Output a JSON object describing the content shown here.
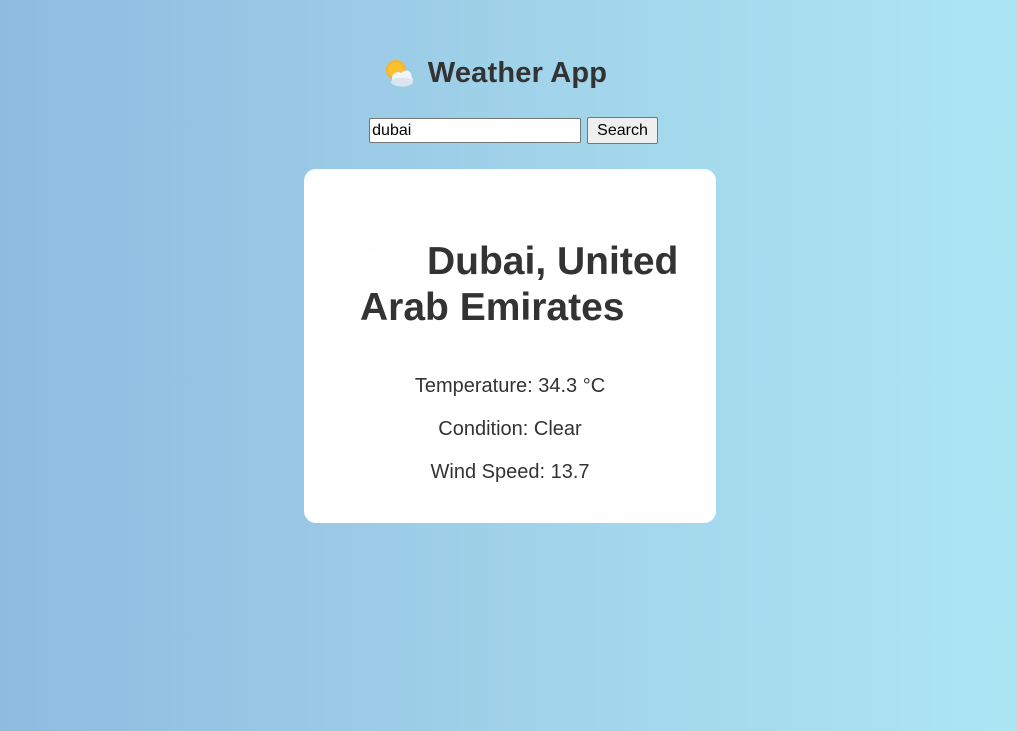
{
  "header": {
    "title": "Weather App",
    "icon": "sun-behind-cloud-icon"
  },
  "search": {
    "value": "dubai",
    "button_label": "Search"
  },
  "weather": {
    "condition_icon": "crescent-moon-icon",
    "location": "Dubai, United Arab Emirates",
    "temperature_label": "Temperature: 34.3 °C",
    "condition_label": "Condition: Clear",
    "wind_label": "Wind Speed: 13.7"
  },
  "colors": {
    "background_start": "#8fbbe0",
    "background_end": "#ace6f5",
    "card": "#ffffff",
    "text": "#333333",
    "moon": "#1a73c8"
  }
}
